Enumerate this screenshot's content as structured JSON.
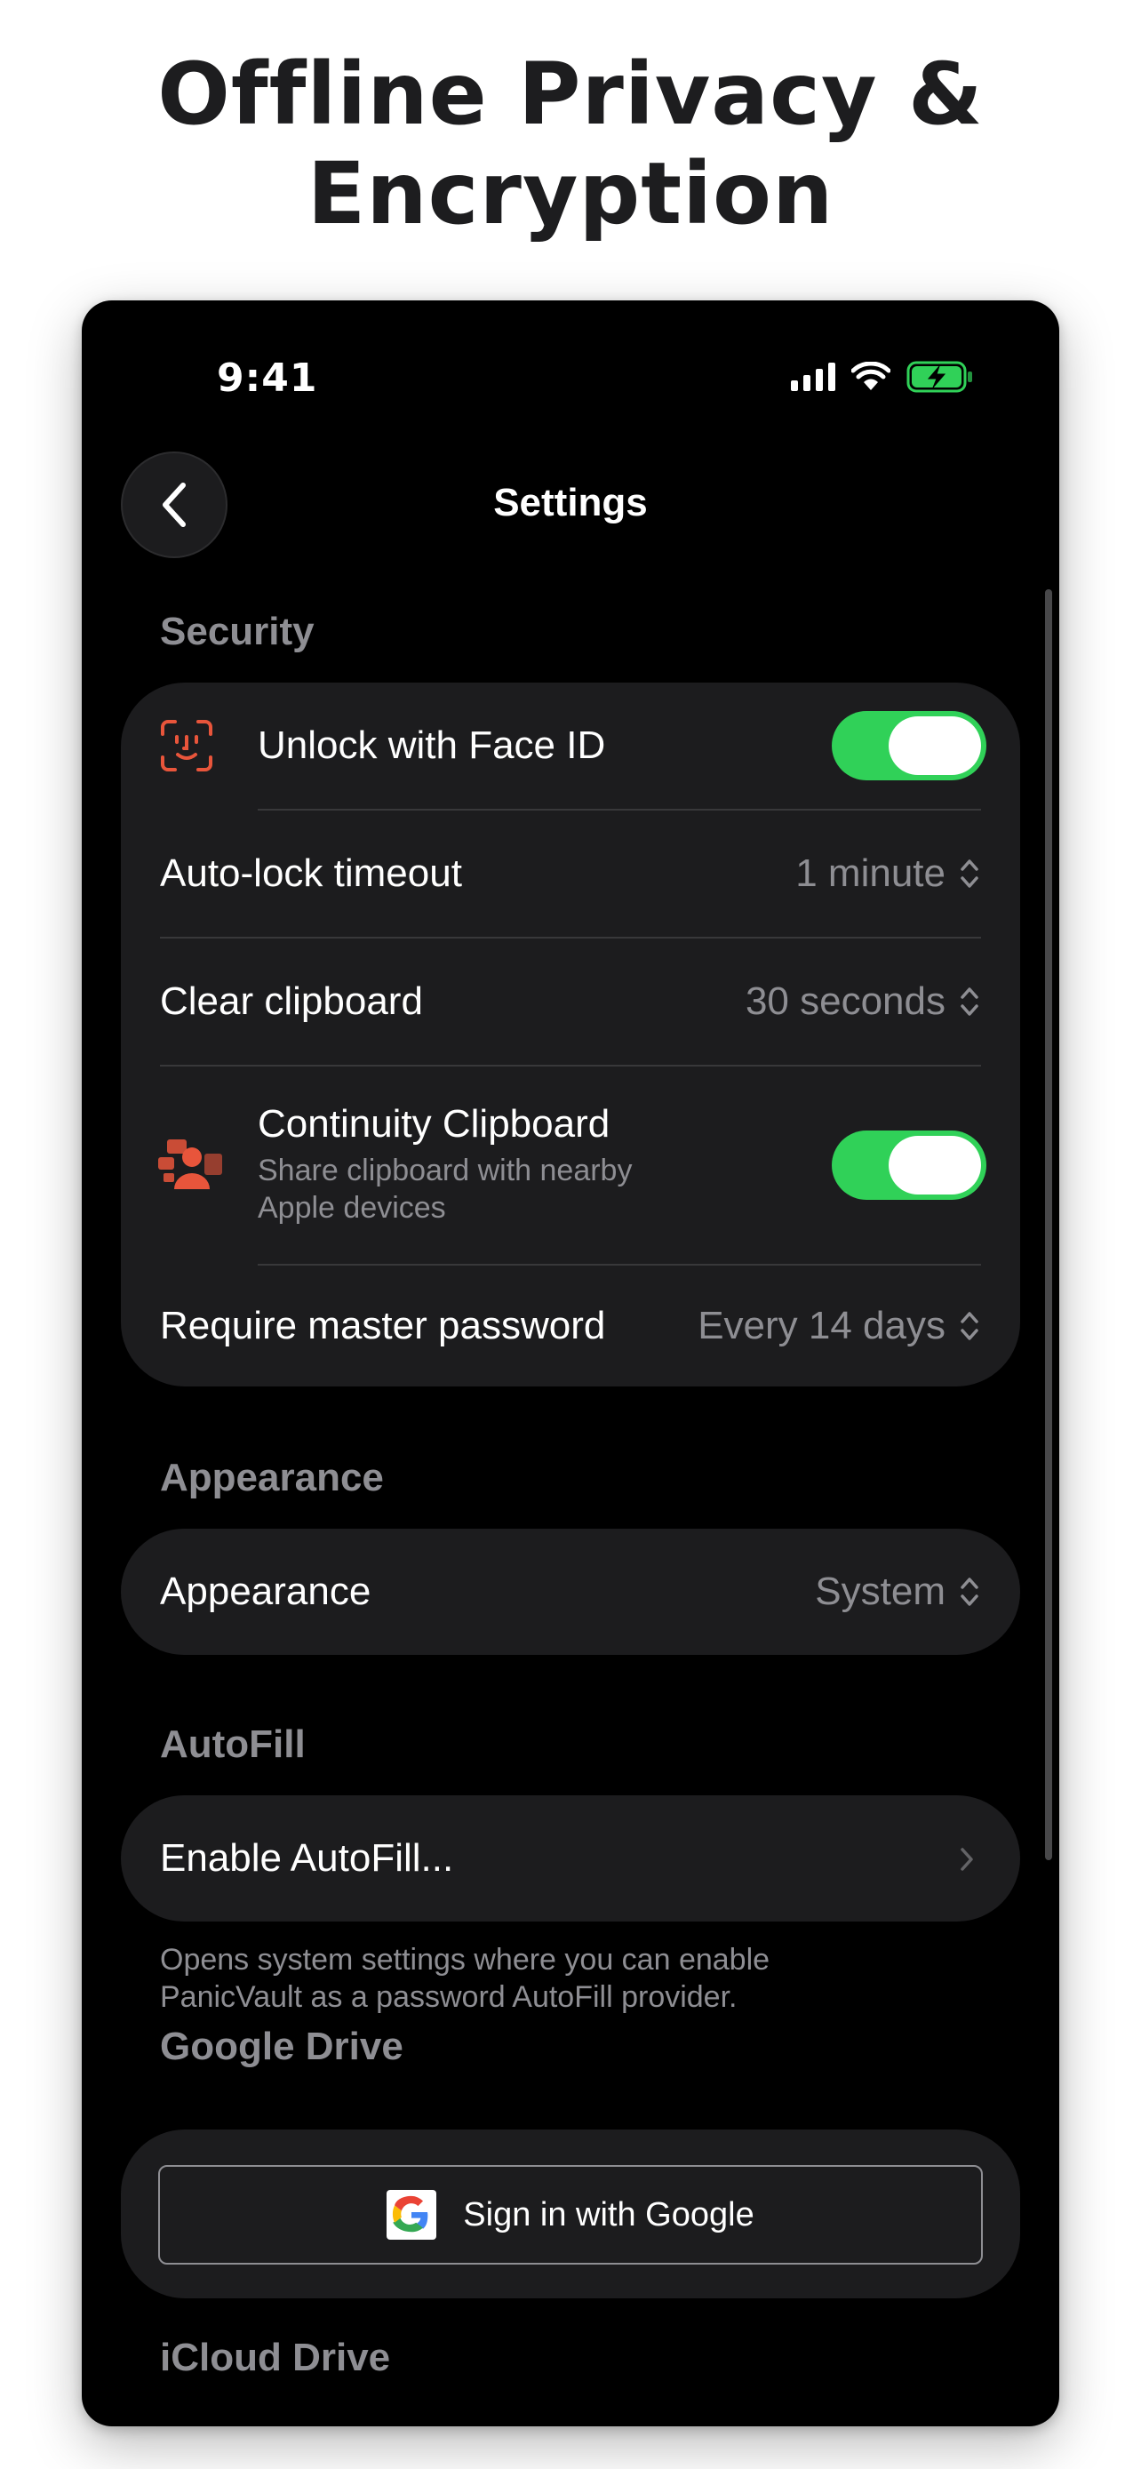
{
  "headline": {
    "line1": "Offline Privacy &",
    "line2": "Encryption"
  },
  "status_bar": {
    "time": "9:41"
  },
  "nav": {
    "title": "Settings"
  },
  "security": {
    "header": "Security",
    "face_id_label": "Unlock with Face ID",
    "face_id_enabled": true,
    "auto_lock_label": "Auto-lock timeout",
    "auto_lock_value": "1 minute",
    "clear_clipboard_label": "Clear clipboard",
    "clear_clipboard_value": "30 seconds",
    "continuity_label": "Continuity Clipboard",
    "continuity_sub1": "Share clipboard with nearby",
    "continuity_sub2": "Apple devices",
    "continuity_enabled": true,
    "master_password_label": "Require master password",
    "master_password_value": "Every 14 days"
  },
  "appearance": {
    "header": "Appearance",
    "label": "Appearance",
    "value": "System"
  },
  "autofill": {
    "header": "AutoFill",
    "label": "Enable AutoFill...",
    "note1": "Opens system settings where you can enable",
    "note2": "PanicVault as a password AutoFill provider."
  },
  "google_drive": {
    "header": "Google Drive",
    "button_label": "Sign in with Google"
  },
  "icloud": {
    "header": "iCloud Drive"
  },
  "colors": {
    "accent_green": "#30d158",
    "icon_orange": "#e8553b",
    "background": "#000000",
    "card": "#1c1c1e"
  }
}
